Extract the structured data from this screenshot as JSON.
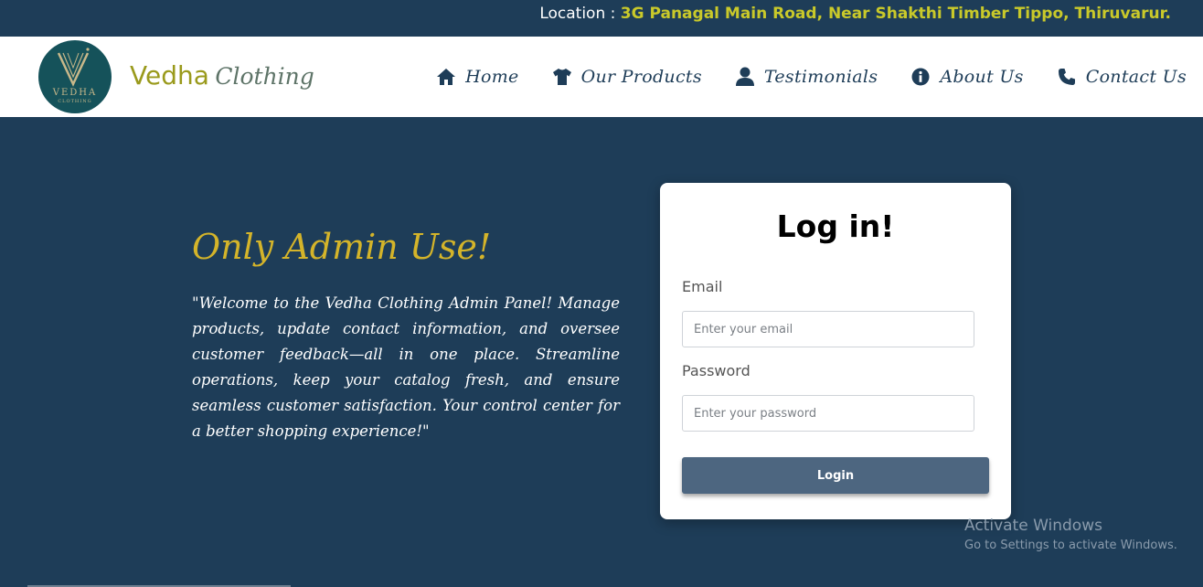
{
  "topbar": {
    "location_label": "Location :",
    "location_address": "3G Panagal Main Road, Near Shakthi Timber Tippo, Thiruvarur."
  },
  "header": {
    "logo_text": "VEDHA",
    "logo_subtext": "CLOTHING",
    "brand_primary": "Vedha",
    "brand_secondary": "Clothing"
  },
  "nav": {
    "items": [
      {
        "label": "Home",
        "icon": "home-icon"
      },
      {
        "label": "Our Products",
        "icon": "tshirt-icon"
      },
      {
        "label": "Testimonials",
        "icon": "user-icon"
      },
      {
        "label": "About Us",
        "icon": "info-icon"
      },
      {
        "label": "Contact Us",
        "icon": "phone-icon"
      }
    ]
  },
  "hero": {
    "title": "Only Admin Use!",
    "text": "\"Welcome to the Vedha Clothing Admin Panel! Manage products, update contact information, and oversee customer feedback—all in one place. Streamline operations, keep your catalog fresh, and ensure seamless customer satisfaction. Your control center for a better shopping experience!\""
  },
  "login": {
    "title": "Log in!",
    "email_label": "Email",
    "email_value": "",
    "email_placeholder": "Enter your email",
    "password_label": "Password",
    "password_value": "",
    "password_placeholder": "Enter your password",
    "button_label": "Login"
  },
  "watermark": {
    "line1": "Activate Windows",
    "line2": "Go to Settings to activate Windows."
  },
  "colors": {
    "background": "#1e3d58",
    "accent_yellow": "#c9c92a",
    "title_gold": "#d4b42a",
    "button": "#4d6680",
    "logo_teal": "#15525a"
  }
}
